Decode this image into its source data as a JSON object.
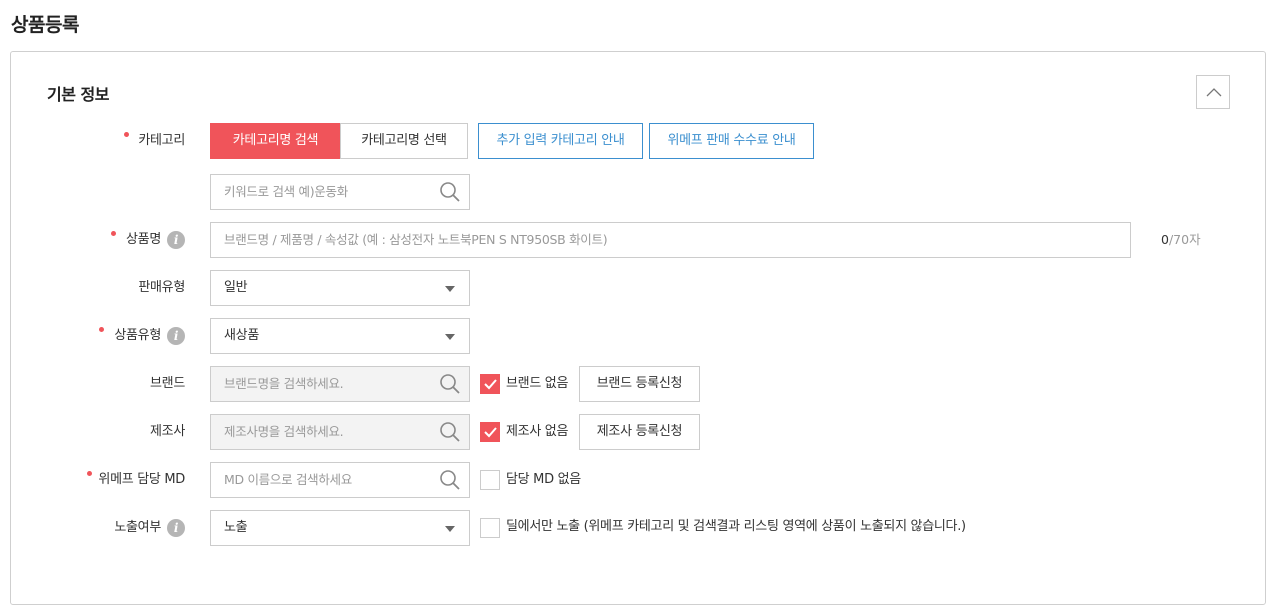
{
  "page_title": "상품등록",
  "section": {
    "title": "기본 정보",
    "collapse_icon": "chevron-up-icon"
  },
  "category": {
    "label": "카테고리",
    "required": true,
    "search_tab": "카테고리명 검색",
    "select_tab": "카테고리명 선택",
    "extra_category_guide": "추가 입력 카테고리 안내",
    "fee_guide": "위메프 판매 수수료 안내",
    "keyword_placeholder": "키워드로 검색 예)운동화"
  },
  "product_name": {
    "label": "상품명",
    "required": true,
    "placeholder": "브랜드명 / 제품명 / 속성값 (예 : 삼성전자 노트북PEN S NT950SB 화이트)",
    "count_current": "0",
    "count_max": "/70자"
  },
  "sale_type": {
    "label": "판매유형",
    "value": "일반"
  },
  "product_type": {
    "label": "상품유형",
    "required": true,
    "value": "새상품"
  },
  "brand": {
    "label": "브랜드",
    "placeholder": "브랜드명을 검색하세요.",
    "no_brand_label": "브랜드 없음",
    "no_brand_checked": true,
    "register_button": "브랜드 등록신청"
  },
  "manufacturer": {
    "label": "제조사",
    "placeholder": "제조사명을 검색하세요.",
    "no_maker_label": "제조사 없음",
    "no_maker_checked": true,
    "register_button": "제조사 등록신청"
  },
  "md": {
    "label": "위메프 담당 MD",
    "required": true,
    "placeholder": "MD 이름으로 검색하세요",
    "no_md_label": "담당 MD 없음",
    "no_md_checked": false
  },
  "exposure": {
    "label": "노출여부",
    "value": "노출",
    "deal_only_label": "딜에서만 노출 (위메프 카테고리 및 검색결과 리스팅 영역에 상품이 노출되지 않습니다.)",
    "deal_only_checked": false
  },
  "colors": {
    "accent": "#f0545a",
    "link_blue": "#3b8fcf"
  }
}
